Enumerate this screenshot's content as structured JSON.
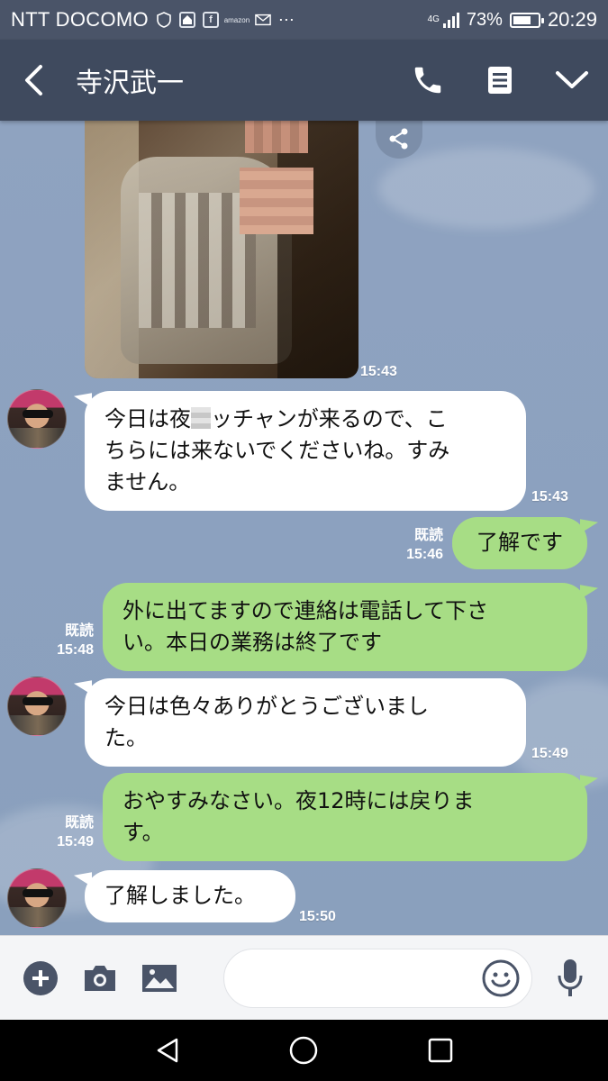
{
  "status_bar": {
    "carrier": "NTT DOCOMO",
    "network": "4G",
    "battery": "73%",
    "battery_level": 0.73,
    "time": "20:29",
    "notif_icons": [
      "shield-icon",
      "home-icon",
      "facebook-icon",
      "amazon-icon",
      "mail-icon",
      "more-dots-icon"
    ]
  },
  "header": {
    "title": "寺沢武一",
    "icons": [
      "back-icon",
      "phone-icon",
      "note-icon",
      "chevron-down-icon"
    ]
  },
  "messages": [
    {
      "type": "image",
      "side": "in",
      "time": "15:43"
    },
    {
      "type": "text",
      "side": "in",
      "lines": [
        "今日は夜",
        "ッチャンが来るので、こ",
        "ちらには来ないでくださいね。すみ",
        "ません。"
      ],
      "time": "15:43"
    },
    {
      "type": "text",
      "side": "out",
      "lines": [
        "了解です"
      ],
      "read": "既読",
      "time": "15:46"
    },
    {
      "type": "text",
      "side": "out",
      "lines": [
        "外に出てますので連絡は電話して下さ",
        "い。本日の業務は終了です"
      ],
      "read": "既読",
      "time": "15:48"
    },
    {
      "type": "text",
      "side": "in",
      "lines": [
        "今日は色々ありがとうございまし",
        "た。"
      ],
      "time": "15:49"
    },
    {
      "type": "text",
      "side": "out",
      "lines": [
        "おやすみなさい。夜12時には戻りま",
        "す。"
      ],
      "read": "既読",
      "time": "15:49"
    },
    {
      "type": "text",
      "side": "in",
      "lines": [
        "了解しました。"
      ],
      "time": "15:50"
    }
  ],
  "input_bar": {
    "icons": [
      "plus-icon",
      "camera-icon",
      "gallery-icon",
      "emoji-icon",
      "mic-icon"
    ],
    "placeholder": ""
  },
  "nav": [
    "back-triangle-icon",
    "home-circle-icon",
    "recents-square-icon"
  ]
}
